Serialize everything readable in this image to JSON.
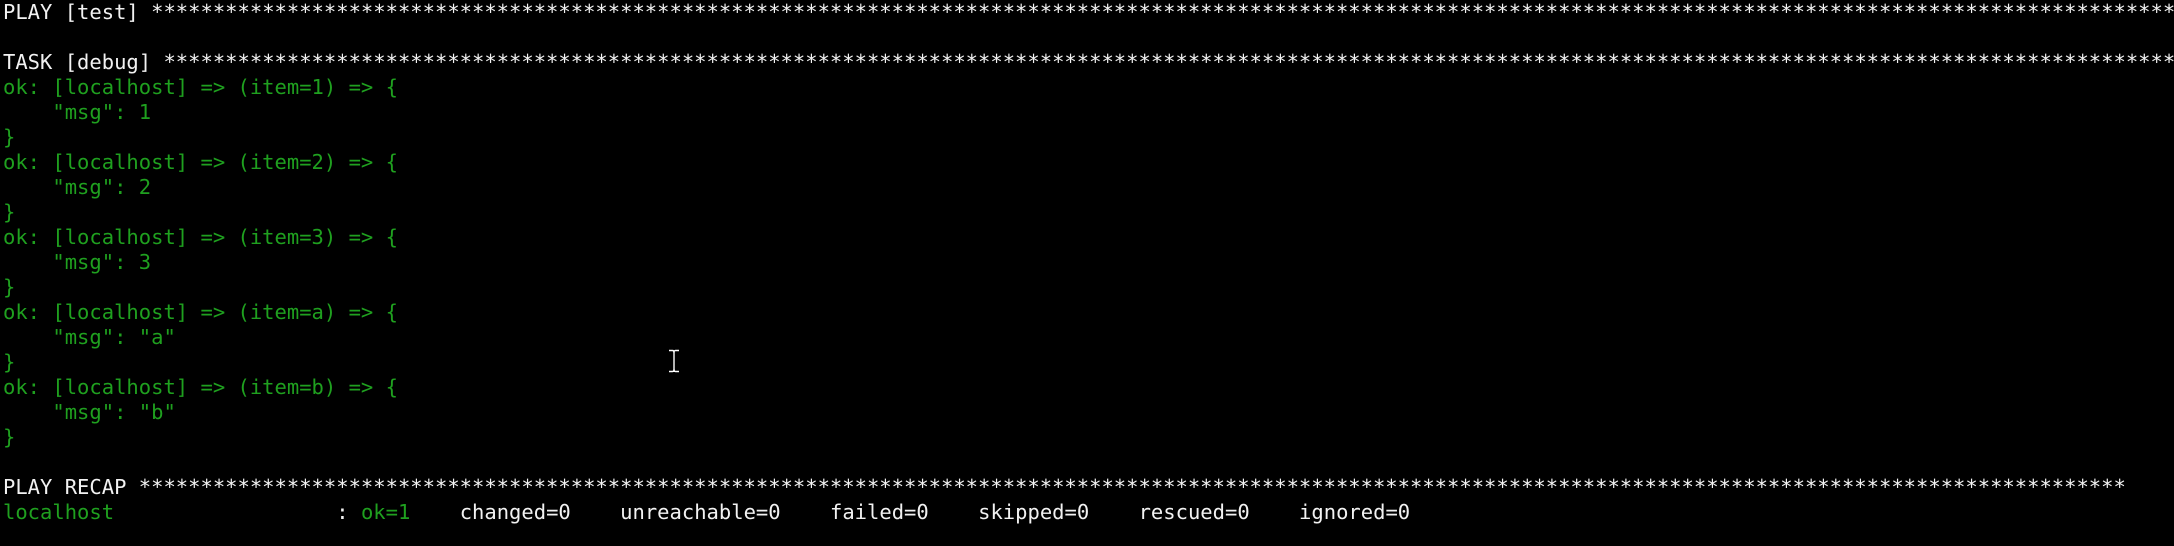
{
  "play_header": {
    "label": "PLAY [test] ",
    "stars": "***********************************************************************************************************************************************************************"
  },
  "task_header": {
    "label": "TASK [debug] ",
    "stars": "**********************************************************************************************************************************************************************"
  },
  "results": [
    {
      "ok_line": "ok: [localhost] => (item=1) => {",
      "msg_line": "    \"msg\": 1",
      "close": "}"
    },
    {
      "ok_line": "ok: [localhost] => (item=2) => {",
      "msg_line": "    \"msg\": 2",
      "close": "}"
    },
    {
      "ok_line": "ok: [localhost] => (item=3) => {",
      "msg_line": "    \"msg\": 3",
      "close": "}"
    },
    {
      "ok_line": "ok: [localhost] => (item=a) => {",
      "msg_line": "    \"msg\": \"a\"",
      "close": "}"
    },
    {
      "ok_line": "ok: [localhost] => (item=b) => {",
      "msg_line": "    \"msg\": \"b\"",
      "close": "}"
    }
  ],
  "recap_header": {
    "label": "PLAY RECAP ",
    "stars": "*****************************************************************************************************************************************************************"
  },
  "recap": {
    "host": "localhost                  ",
    "separator": ": ",
    "ok": "ok=1",
    "gap1": "    ",
    "changed": "changed=0",
    "gap2": "    ",
    "unreachable": "unreachable=0",
    "gap3": "    ",
    "failed": "failed=0",
    "gap4": "    ",
    "skipped": "skipped=0",
    "gap5": "    ",
    "rescued": "rescued=0",
    "gap6": "    ",
    "ignored": "ignored=0"
  },
  "colors": {
    "background": "#000000",
    "text": "#f2f2f2",
    "ok_green": "#1fa01f"
  },
  "icons": {
    "cursor": "text-cursor-ibeam-icon"
  }
}
